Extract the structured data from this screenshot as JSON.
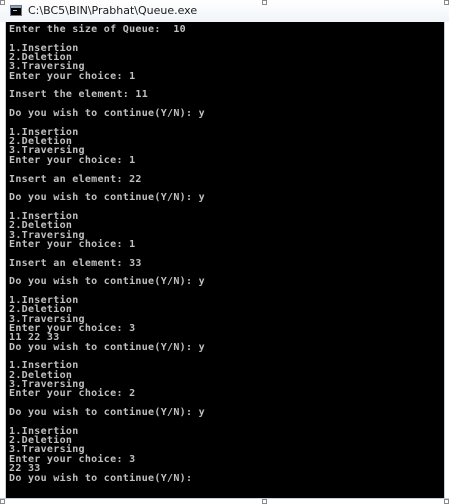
{
  "window": {
    "title": "C:\\BC5\\BIN\\Prabhat\\Queue.exe"
  },
  "console": {
    "lines": [
      "Enter the size of Queue:  10",
      "",
      "1.Insertion",
      "2.Deletion",
      "3.Traversing",
      "Enter your choice: 1",
      "",
      "Insert the element: 11",
      "",
      "Do you wish to continue(Y/N): y",
      "",
      "1.Insertion",
      "2.Deletion",
      "3.Traversing",
      "Enter your choice: 1",
      "",
      "Insert an element: 22",
      "",
      "Do you wish to continue(Y/N): y",
      "",
      "1.Insertion",
      "2.Deletion",
      "3.Traversing",
      "Enter your choice: 1",
      "",
      "Insert an element: 33",
      "",
      "Do you wish to continue(Y/N): y",
      "",
      "1.Insertion",
      "2.Deletion",
      "3.Traversing",
      "Enter your choice: 3",
      "11 22 33",
      "Do you wish to continue(Y/N): y",
      "",
      "1.Insertion",
      "2.Deletion",
      "3.Traversing",
      "Enter your choice: 2",
      "",
      "Do you wish to continue(Y/N): y",
      "",
      "1.Insertion",
      "2.Deletion",
      "3.Traversing",
      "Enter your choice: 3",
      "22 33",
      "Do you wish to continue(Y/N):",
      "",
      ""
    ]
  }
}
